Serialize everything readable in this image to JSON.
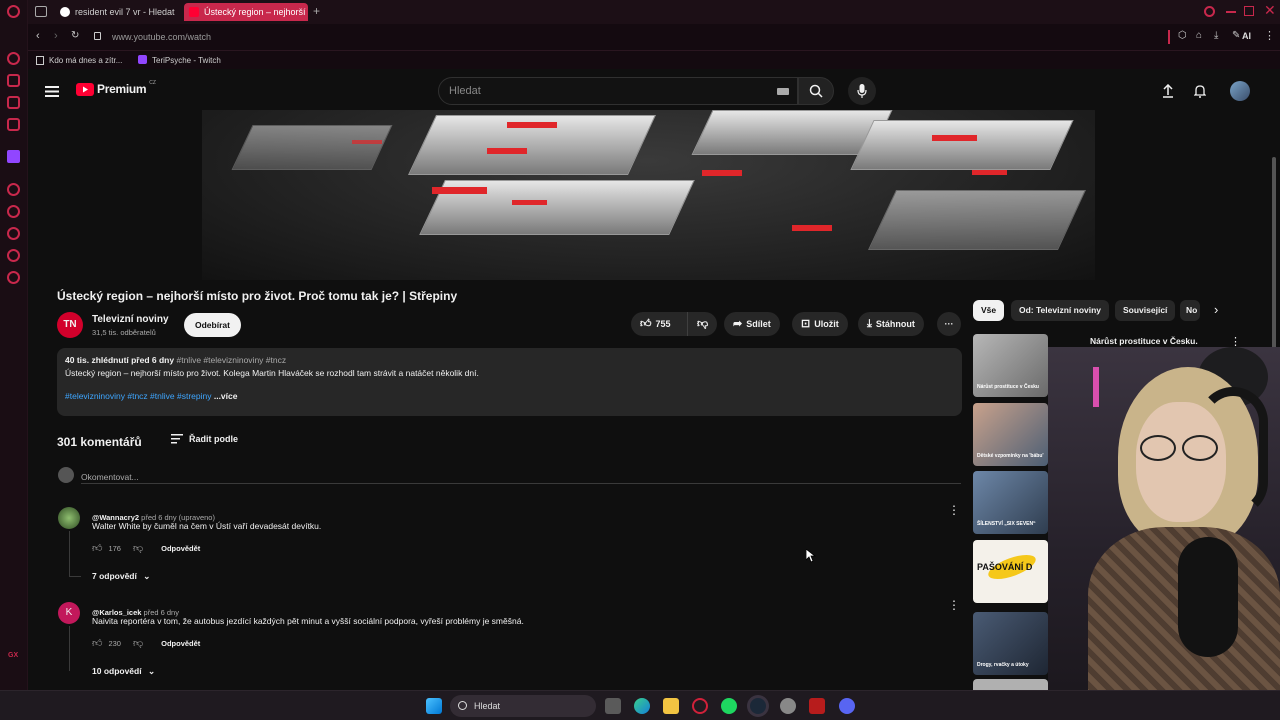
{
  "browser": {
    "tabs": [
      {
        "label": "resident evil 7 vr - Hledat"
      },
      {
        "label": "Ústecký region – nejhorší m"
      }
    ],
    "new_tab": "+",
    "url": "www.youtube.com/watch",
    "ai_label": "AI",
    "bookmarks": [
      {
        "label": "Kdo má dnes a zítr..."
      },
      {
        "label": "TeriPsyche - Twitch"
      }
    ]
  },
  "youtube": {
    "logo": "Premium",
    "logo_region": "CZ",
    "search_placeholder": "Hledat",
    "video": {
      "title": "Ústecký region – nejhorší místo pro život. Proč tomu tak je? | Střepiny",
      "channel_initials": "TN",
      "channel_name": "Televizní noviny",
      "subscribers": "31,5 tis. odběratelů",
      "subscribe_label": "Odebírat",
      "likes": "755",
      "share_label": "Sdílet",
      "save_label": "Uložit",
      "download_label": "Stáhnout"
    },
    "description": {
      "stats": "40 tis. zhlédnutí  před 6 dny",
      "hashtags_top": "#tnlive #televizninoviny #tncz",
      "text": "Ústecký region – nejhorší místo pro život. Kolega Martin Hlaváček se rozhodl tam strávit a natáčet několik dní.",
      "hashtags": "#televizninoviny #tncz #tnlive #strepiny",
      "more": "...více"
    },
    "comments": {
      "count_label": "301 komentářů",
      "sort_label": "Řadit podle",
      "add_placeholder": "Okomentovat...",
      "items": [
        {
          "author": "@Wannacry2",
          "meta": "před 6 dny (upraveno)",
          "text": "Walter White by čuměl na čem v Ústí vaří devadesát devítku.",
          "likes": "176",
          "reply": "Odpovědět",
          "replies": "7 odpovědí"
        },
        {
          "author": "@Karlos_icek",
          "avatar_letter": "K",
          "meta": "před 6 dny",
          "text": "Naivita reportéra v tom, že autobus jezdící každých pět minut a vyšší sociální podpora, vyřeší problémy je směšná.",
          "likes": "230",
          "reply": "Odpovědět",
          "replies": "10 odpovědí"
        }
      ]
    },
    "chips": [
      "Vše",
      "Od: Televizní noviny",
      "Související",
      "No"
    ],
    "recommendations": [
      {
        "title": "Nárůst prostituce v Česku.",
        "caption": "Nárůst prostituce v Česku"
      },
      {
        "caption": "Dětské vzpomínky na 'bábu'"
      },
      {
        "caption": "ŠÍLENSTVÍ „SIX SEVEN“"
      },
      {
        "caption": "PAŠOVÁNÍ D"
      },
      {
        "caption": "Drogy, rvačky a útoky"
      }
    ]
  },
  "taskbar": {
    "search_label": "Hledat"
  },
  "colors": {
    "accent": "#ff0033",
    "link": "#3ea6ff",
    "browser_accent": "#c8284c"
  }
}
